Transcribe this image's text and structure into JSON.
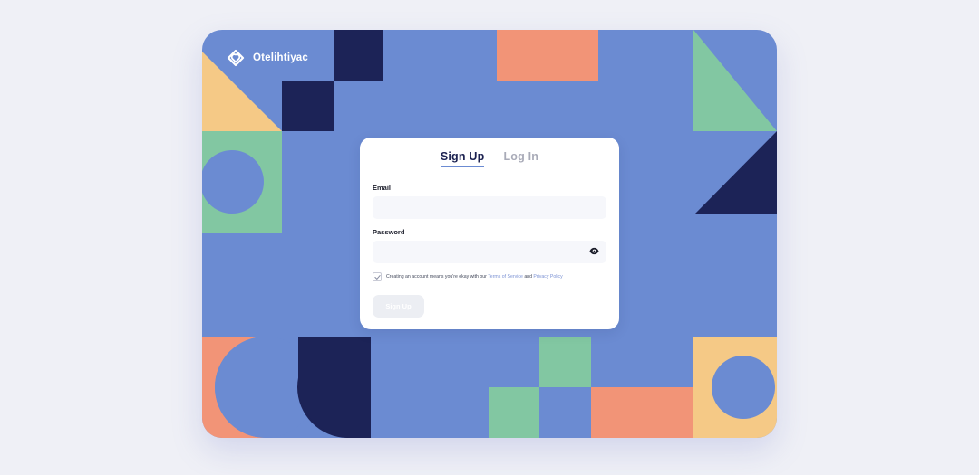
{
  "brand": {
    "name": "Otelihtiyac",
    "logo_icon": "heart-diamond-logo-icon"
  },
  "tabs": [
    {
      "label": "Sign Up",
      "active": true
    },
    {
      "label": "Log In",
      "active": false
    }
  ],
  "form": {
    "email_label": "Email",
    "email_value": "",
    "password_label": "Password",
    "password_value": "",
    "password_toggle_icon": "eye-icon",
    "terms_checked": true,
    "terms_prefix": "Creating an account means you're okay with our",
    "terms_link": "Terms of Service",
    "terms_and": "and",
    "privacy_link": "Privacy Policy",
    "submit_label": "Sign Up"
  },
  "colors": {
    "background_blue": "#6b8bd2",
    "navy": "#1c2357",
    "green": "#82c7a2",
    "coral": "#f29477",
    "sand": "#f5c986",
    "page": "#eff0f6"
  }
}
